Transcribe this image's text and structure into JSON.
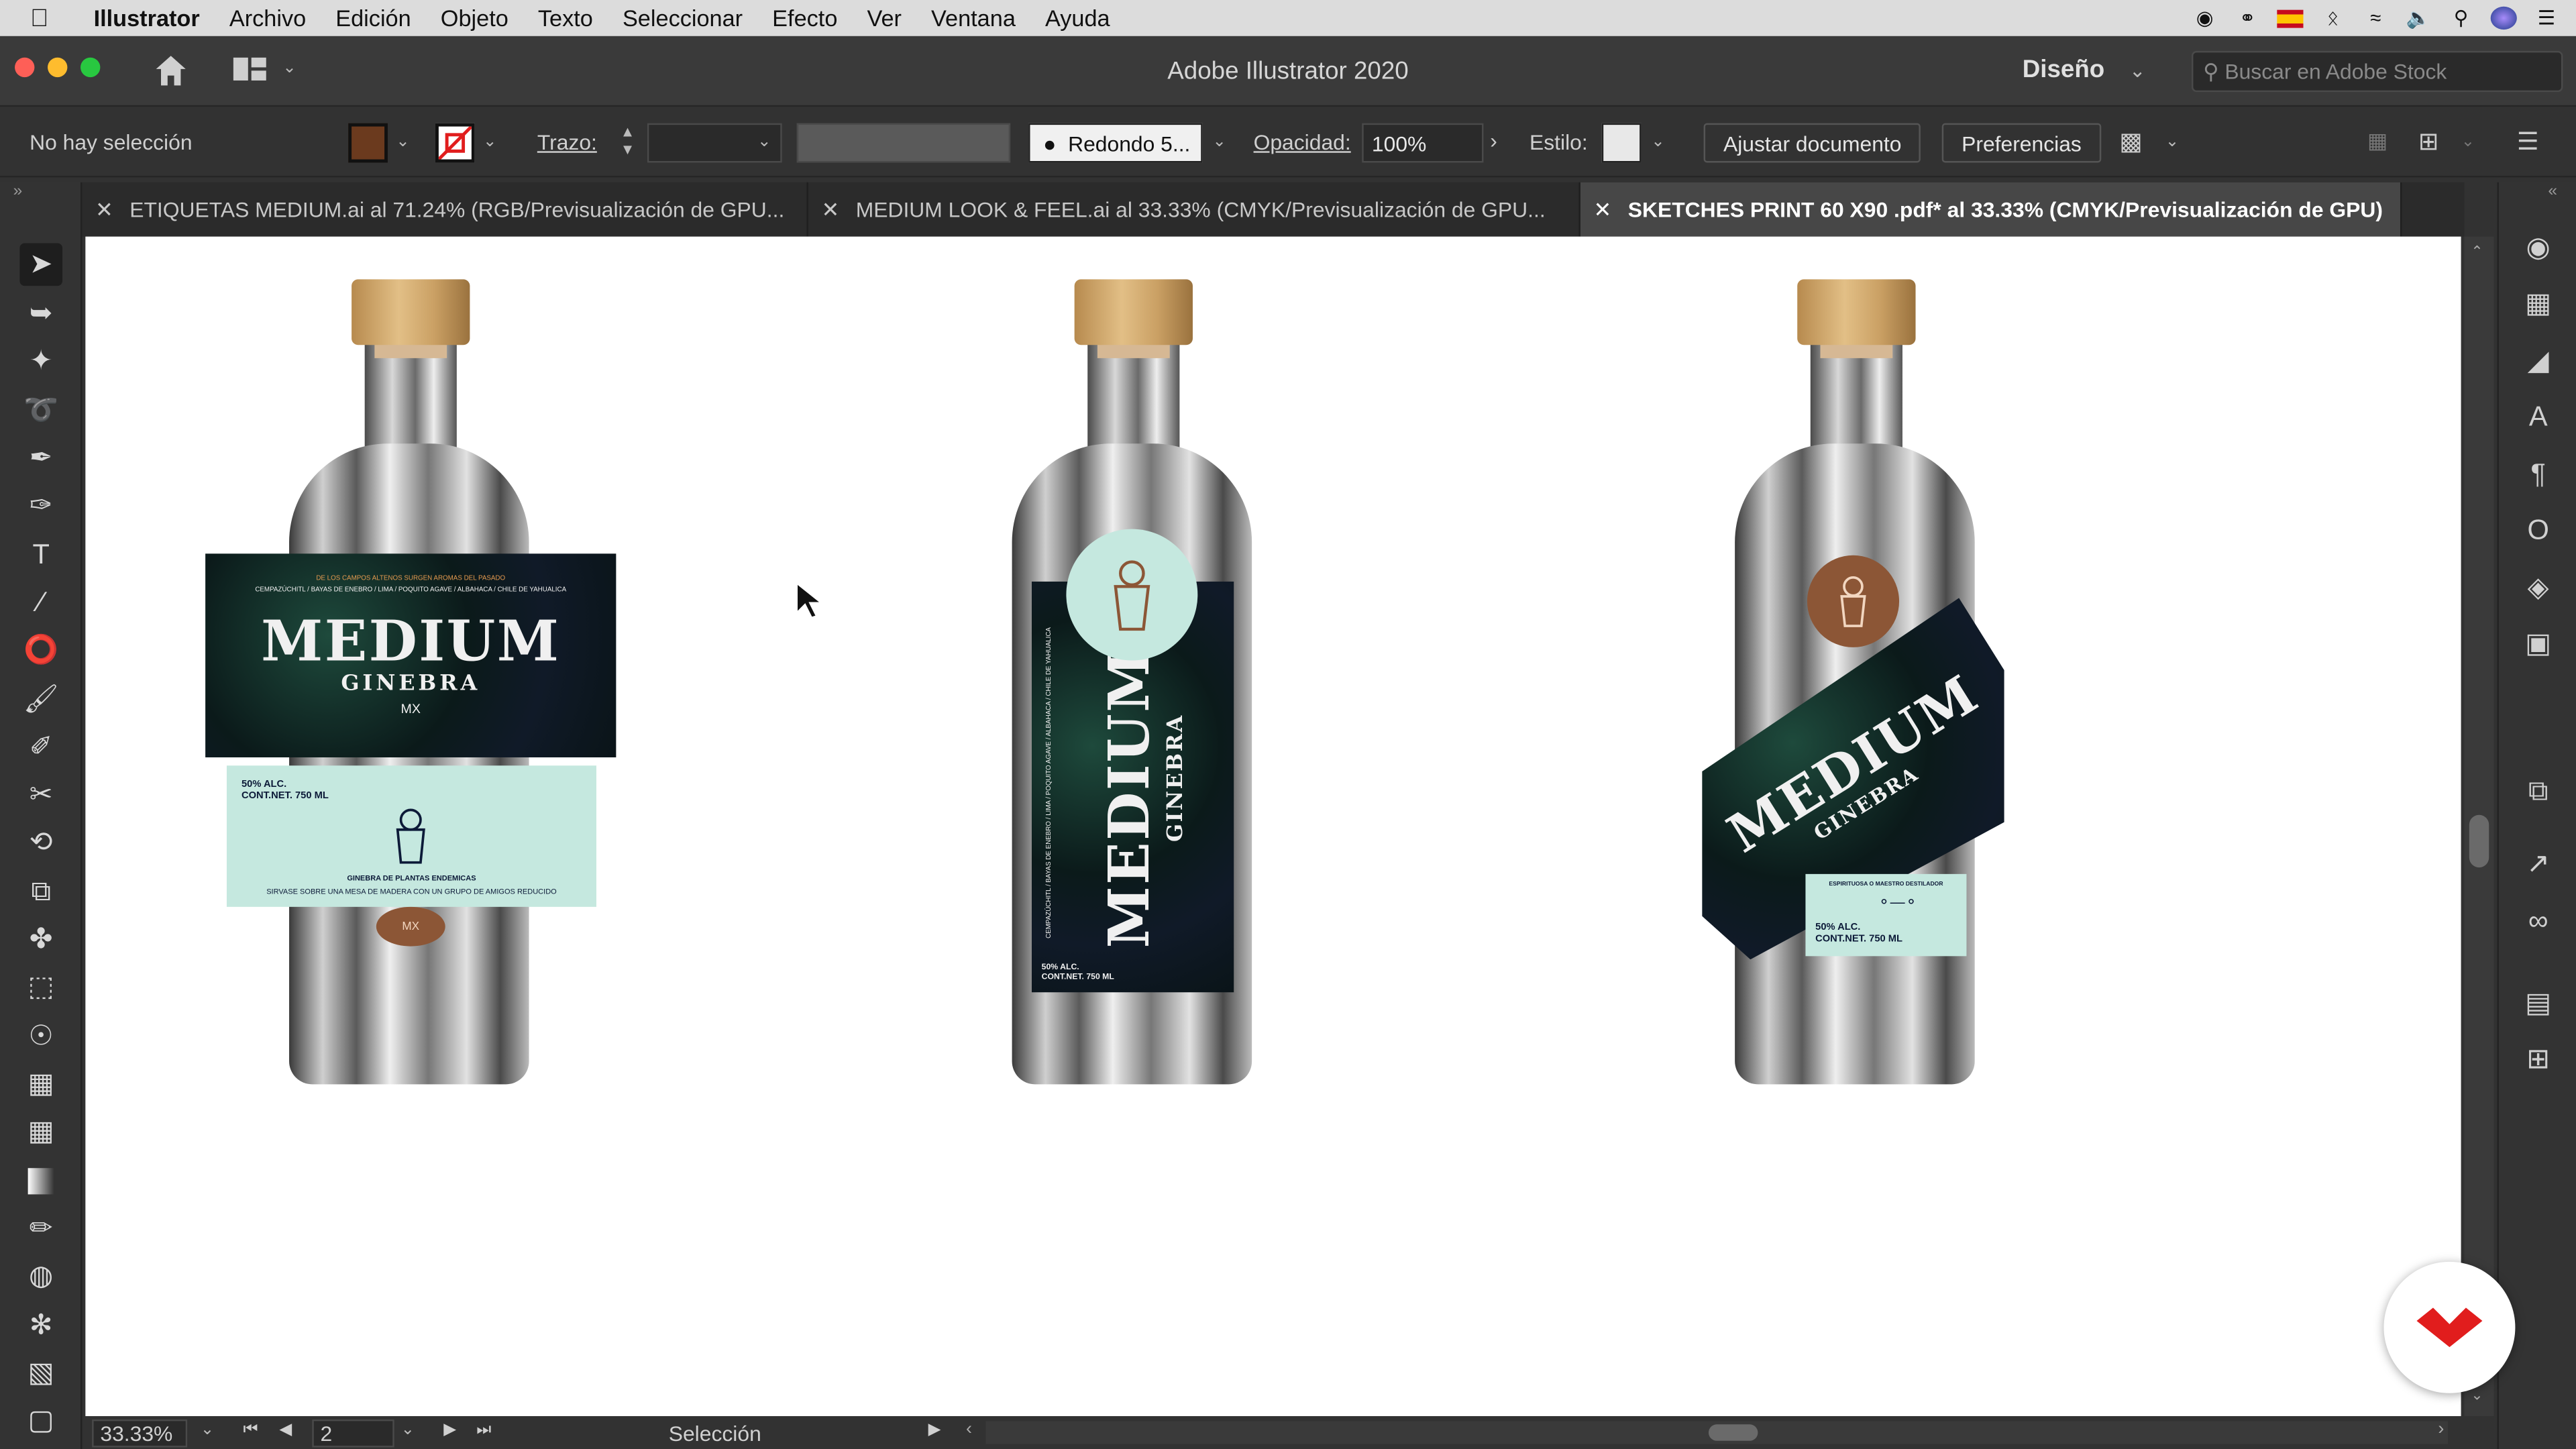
{
  "menubar": {
    "app_name": "Illustrator",
    "items": [
      "Archivo",
      "Edición",
      "Objeto",
      "Texto",
      "Seleccionar",
      "Efecto",
      "Ver",
      "Ventana",
      "Ayuda"
    ]
  },
  "window": {
    "title": "Adobe Illustrator 2020",
    "workspace": "Diseño",
    "stock_search_placeholder": "Buscar en Adobe Stock"
  },
  "control_bar": {
    "selection_status": "No hay selección",
    "stroke_label": "Trazo:",
    "brush_label": "Redondo 5...",
    "opacity_label": "Opacidad:",
    "opacity_value": "100%",
    "style_label": "Estilo:",
    "fit_document_button": "Ajustar documento",
    "preferences_button": "Preferencias",
    "fill_color": "#6b3a1e"
  },
  "tabs": [
    {
      "label": "ETIQUETAS MEDIUM.ai al 71.24% (RGB/Previsualización de GPU..."
    },
    {
      "label": "MEDIUM LOOK & FEEL.ai al 33.33% (CMYK/Previsualización de GPU..."
    },
    {
      "label": "SKETCHES PRINT 60 X90 .pdf* al 33.33% (CMYK/Previsualización de GPU)"
    }
  ],
  "artwork": {
    "brand": "MEDIUM",
    "sub": "GINEBRA",
    "mx": "MX",
    "bottle1": {
      "top_line": "DE LOS CAMPOS ALTENOS SURGEN AROMAS DEL PASADO",
      "ingredients": "CEMPAZÚCHITL / BAYAS DE ENEBRO / LIMA / POQUITO AGAVE / ALBAHACA / CHILE DE YAHUALICA",
      "alc": "50% ALC.",
      "content": "CONT.NET. 750 ML",
      "desc": "GINEBRA DE PLANTAS ENDEMICAS",
      "serve": "SIRVASE SOBRE UNA MESA DE MADERA CON UN GRUPO DE AMIGOS REDUCIDO"
    },
    "bottle2": {
      "ingredients": "CEMPAZÚCHITL / BAYAS DE ENEBRO / LIMA / POQUITO AGAVE / ALBAHACA / CHILE DE YAHUALICA",
      "alc": "50% ALC.",
      "content": "CONT.NET. 750 ML"
    },
    "bottle3": {
      "tag": "ESPIRITUOSA O MAESTRO DESTILADOR",
      "alc": "50% ALC.",
      "content": "CONT.NET. 750 ML"
    }
  },
  "status_bar": {
    "zoom": "33.33%",
    "artboard": "2",
    "tool": "Selección"
  },
  "colors": {
    "accent_red": "#e11d1d",
    "label_teal": "#c5e8df",
    "seal_brown": "#8c5636"
  }
}
